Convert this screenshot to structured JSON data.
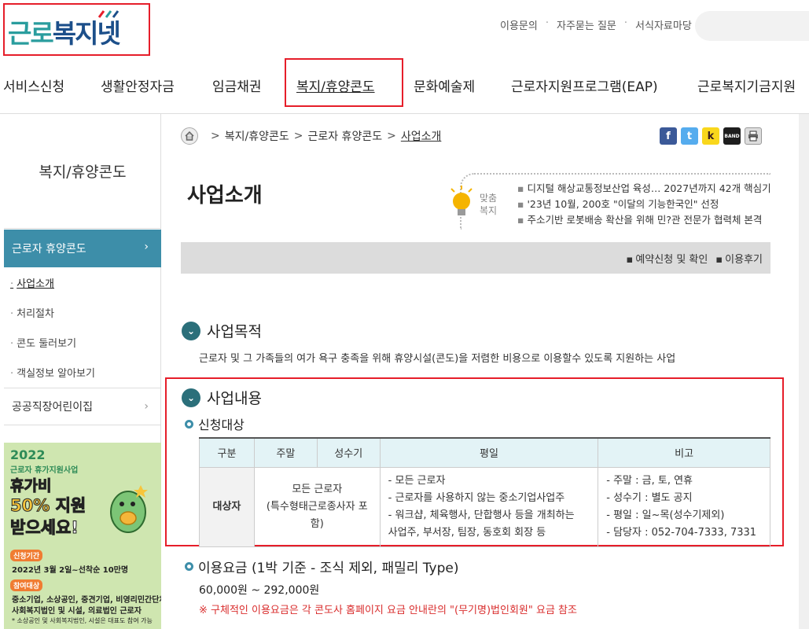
{
  "header": {
    "logo": {
      "part1": "근로",
      "part2": "복지넷"
    },
    "util_links": [
      "이용문의",
      "자주묻는 질문",
      "서식자료마당"
    ],
    "gnb": [
      "서비스신청",
      "생활안정자금",
      "임금채권",
      "복지/휴양콘도",
      "문화예술제",
      "근로자지원프로그램(EAP)",
      "근로복지기금지원"
    ]
  },
  "sidebar": {
    "title": "복지/휴양콘도",
    "head": "근로자 휴양콘도",
    "items": [
      "사업소개",
      "처리절차",
      "콘도 둘러보기",
      "객실정보 알아보기"
    ],
    "other": "공공직장어린이집"
  },
  "banner": {
    "year": "2022",
    "sub": "근로자 휴가지원사업",
    "line1": "휴가비",
    "line2a": "50%",
    "line2b": " 지원",
    "line3": "받으세요!",
    "tag1": "신청기간",
    "period": "2022년 3월 2일~선착순 10만명",
    "tag2": "참여대상",
    "target1": "중소기업, 소상공인, 중견기업, 비영리민간단체,",
    "target2": "사회복지법인 및 시설, 의료법인 근로자",
    "note": "* 소상공인 및 사회복지법인, 시설은 대표도 참여 가능"
  },
  "breadcrumb": [
    "복지/휴양콘도",
    "근로자 휴양콘도",
    "사업소개"
  ],
  "share": [
    "f",
    "t",
    "k",
    "BAND",
    "print"
  ],
  "page_title": "사업소개",
  "recommend": {
    "label": "맞춤 복지",
    "items": [
      "디지털 해상교통정보산업 육성… 2027년까지 42개 핵심기",
      "'23년 10월, 200호 \"이달의 기능한국인\" 선정",
      "주소기반 로봇배송 확산을 위해 민?관 전문가 협력체 본격"
    ]
  },
  "quick_links": [
    "예약신청 및 확인",
    "이용후기"
  ],
  "purpose": {
    "heading": "사업목적",
    "text": "근로자 및 그 가족들의 여가 욕구 충족을 위해 휴양시설(콘도)을 저렴한 비용으로 이용할수 있도록 지원하는 사업"
  },
  "content": {
    "heading": "사업내용",
    "subheading": "신청대상",
    "table": {
      "headers": [
        "구분",
        "주말",
        "성수기",
        "평일",
        "비고"
      ],
      "row_label": "대상자",
      "weekend_peak": [
        "모든 근로자",
        "(특수형태근로종사자 포",
        "함)"
      ],
      "weekday": [
        "- 모든 근로자",
        "- 근로자를 사용하지 않는 중소기업사업주",
        "- 워크샵, 체육행사, 단합행사 등을 개최하는",
        "사업주, 부서장, 팀장, 동호회 회장 등"
      ],
      "notes": [
        "- 주말 : 금, 토, 연휴",
        "- 성수기 : 별도 공지",
        "- 평일 : 일~목(성수기제외)",
        "- 담당자 : 052-704-7333, 7331"
      ]
    }
  },
  "fee": {
    "heading": "이용요금 (1박 기준 - 조식 제외, 패밀리 Type)",
    "value": "60,000원 ~ 292,000원",
    "note": "※ 구체적인 이용요금은 각 콘도사 홈페이지 요금 안내란의 \"(무기명)법인회원\" 요금 참조"
  },
  "colors": {
    "accent": "#3d8ea9",
    "highlight_border": "#e61e2a",
    "section_icon": "#2b6f7a"
  }
}
